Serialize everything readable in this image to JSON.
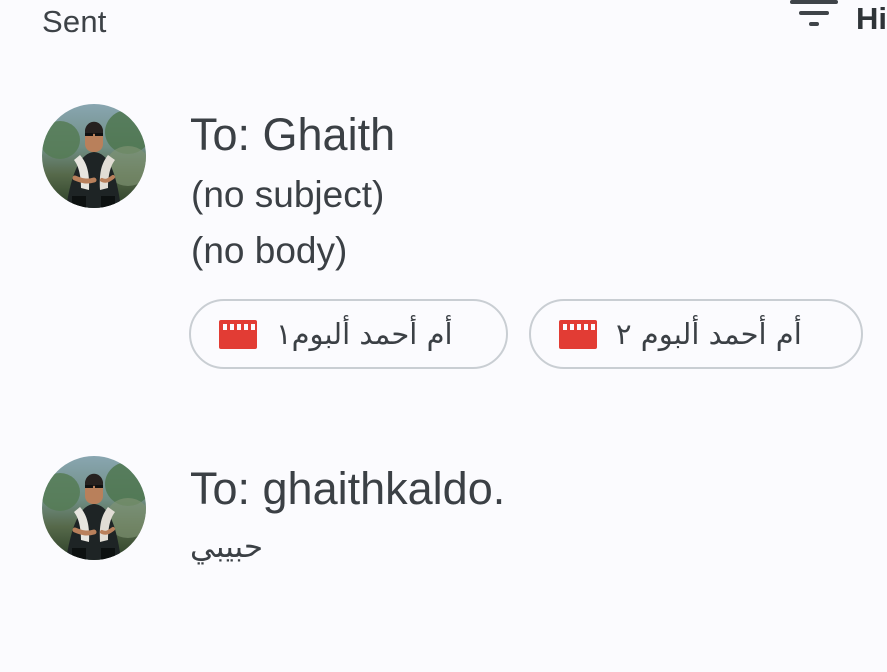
{
  "header": {
    "section_title": "Sent",
    "filter_label": "Hi",
    "filter_icon": "filter-icon"
  },
  "emails": [
    {
      "recipient": "To: Ghaith",
      "subject": "(no subject)",
      "body": "(no body)",
      "avatar_icon": "avatar-photo",
      "attachments": [
        {
          "name": "أم أحمد ألبوم١",
          "icon": "video-clapperboard-icon",
          "icon_color": "#e23c34"
        },
        {
          "name": "أم أحمد ألبوم ٢",
          "icon": "video-clapperboard-icon",
          "icon_color": "#e23c34"
        }
      ]
    },
    {
      "recipient": "To: ghaithkaldo.",
      "snippet": "حبيبي",
      "avatar_icon": "avatar-photo"
    }
  ],
  "colors": {
    "background": "#fbfbfe",
    "text": "#3b4045",
    "chip_border": "#c9ced3",
    "attachment_icon": "#e23c34"
  }
}
